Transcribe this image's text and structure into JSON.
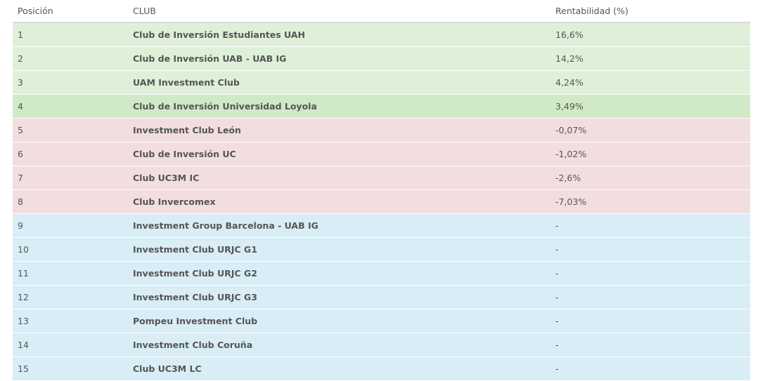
{
  "header": {
    "position": "Posición",
    "club": "CLUB",
    "return": "Rentabilidad (%)"
  },
  "colors": {
    "positive": "#dff0d8",
    "positive_highlight": "#d0e9c6",
    "negative": "#f2dede",
    "no_data": "#d9edf7"
  },
  "rows": [
    {
      "pos": "1",
      "club": "Club de Inversión Estudiantes UAH",
      "ret": "16,6%",
      "status": "green"
    },
    {
      "pos": "2",
      "club": "Club de Inversión UAB - UAB IG",
      "ret": "14,2%",
      "status": "green"
    },
    {
      "pos": "3",
      "club": "UAM Investment Club",
      "ret": "4,24%",
      "status": "green"
    },
    {
      "pos": "4",
      "club": "Club de Inversión Universidad Loyola",
      "ret": "3,49%",
      "status": "green-hover"
    },
    {
      "pos": "5",
      "club": "Investment Club León",
      "ret": "-0,07%",
      "status": "red"
    },
    {
      "pos": "6",
      "club": "Club de Inversión UC",
      "ret": "-1,02%",
      "status": "red"
    },
    {
      "pos": "7",
      "club": "Club UC3M IC",
      "ret": "-2,6%",
      "status": "red"
    },
    {
      "pos": "8",
      "club": "Club Invercomex",
      "ret": "-7,03%",
      "status": "red"
    },
    {
      "pos": "9",
      "club": "Investment Group Barcelona - UAB IG",
      "ret": "-",
      "status": "blue"
    },
    {
      "pos": "10",
      "club": "Investment Club URJC G1",
      "ret": "-",
      "status": "blue"
    },
    {
      "pos": "11",
      "club": "Investment Club URJC G2",
      "ret": "-",
      "status": "blue"
    },
    {
      "pos": "12",
      "club": "Investment Club URJC G3",
      "ret": "-",
      "status": "blue"
    },
    {
      "pos": "13",
      "club": "Pompeu Investment Club",
      "ret": "-",
      "status": "blue"
    },
    {
      "pos": "14",
      "club": "Investment Club Coruña",
      "ret": "-",
      "status": "blue"
    },
    {
      "pos": "15",
      "club": "Club UC3M LC",
      "ret": "-",
      "status": "blue"
    }
  ]
}
